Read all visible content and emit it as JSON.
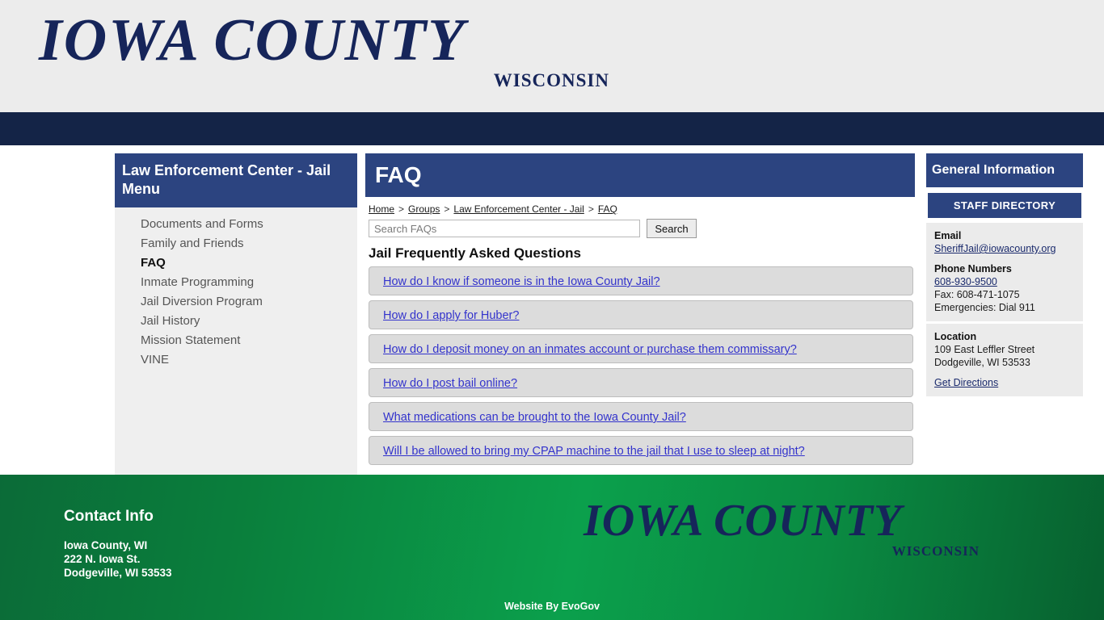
{
  "header": {
    "logo_main": "IOWA COUNTY",
    "logo_sub": "WISCONSIN"
  },
  "sidebar": {
    "title": "Law Enforcement Center - Jail Menu",
    "items": [
      {
        "label": "Documents and Forms",
        "active": false
      },
      {
        "label": "Family and Friends",
        "active": false
      },
      {
        "label": "FAQ",
        "active": true
      },
      {
        "label": "Inmate Programming",
        "active": false
      },
      {
        "label": "Jail Diversion Program",
        "active": false
      },
      {
        "label": "Jail History",
        "active": false
      },
      {
        "label": "Mission Statement",
        "active": false
      },
      {
        "label": "VINE",
        "active": false
      }
    ]
  },
  "main": {
    "page_title": "FAQ",
    "breadcrumb": [
      {
        "label": "Home"
      },
      {
        "label": "Groups"
      },
      {
        "label": "Law Enforcement Center - Jail"
      },
      {
        "label": "FAQ"
      }
    ],
    "breadcrumb_separator": ">",
    "search": {
      "placeholder": "Search FAQs",
      "value": "",
      "button_label": "Search"
    },
    "section_title": "Jail Frequently Asked Questions",
    "faqs": [
      "How do I know if someone is in the Iowa County Jail?",
      "How do I apply for Huber?",
      "How do I deposit money on an inmates account or purchase them commissary?",
      "How do I post bail online?",
      "What medications can be brought to the Iowa County Jail?",
      "Will I be allowed to bring my CPAP machine to the jail that I use to sleep at night?"
    ]
  },
  "right_panel": {
    "title": "General Information",
    "staff_directory_label": "STAFF DIRECTORY",
    "email_label": "Email",
    "email_value": "SheriffJail@iowacounty.org",
    "phone_label": "Phone Numbers",
    "phone_value": "608-930-9500",
    "fax_value": "Fax: 608-471-1075",
    "emergency_value": "Emergencies: Dial 911",
    "location_label": "Location",
    "location_line1": "109 East Leffler Street",
    "location_line2": "Dodgeville, WI 53533",
    "directions_label": "Get Directions"
  },
  "footer": {
    "contact_title": "Contact Info",
    "contact_line1": "Iowa County, WI",
    "contact_line2": "222 N. Iowa St.",
    "contact_line3": "Dodgeville, WI 53533",
    "logo_main": "IOWA COUNTY",
    "logo_sub": "WISCONSIN",
    "credit": "Website By EvoGov"
  },
  "colors": {
    "navy_dark": "#142447",
    "navy_panel": "#2c4480",
    "header_bg": "#ececec",
    "sidebar_bg": "#efefef",
    "faq_item_bg": "#dcdcdc",
    "link_blue": "#3333cc",
    "footer_green": "#0ba04c",
    "logo_navy": "#16255a"
  }
}
